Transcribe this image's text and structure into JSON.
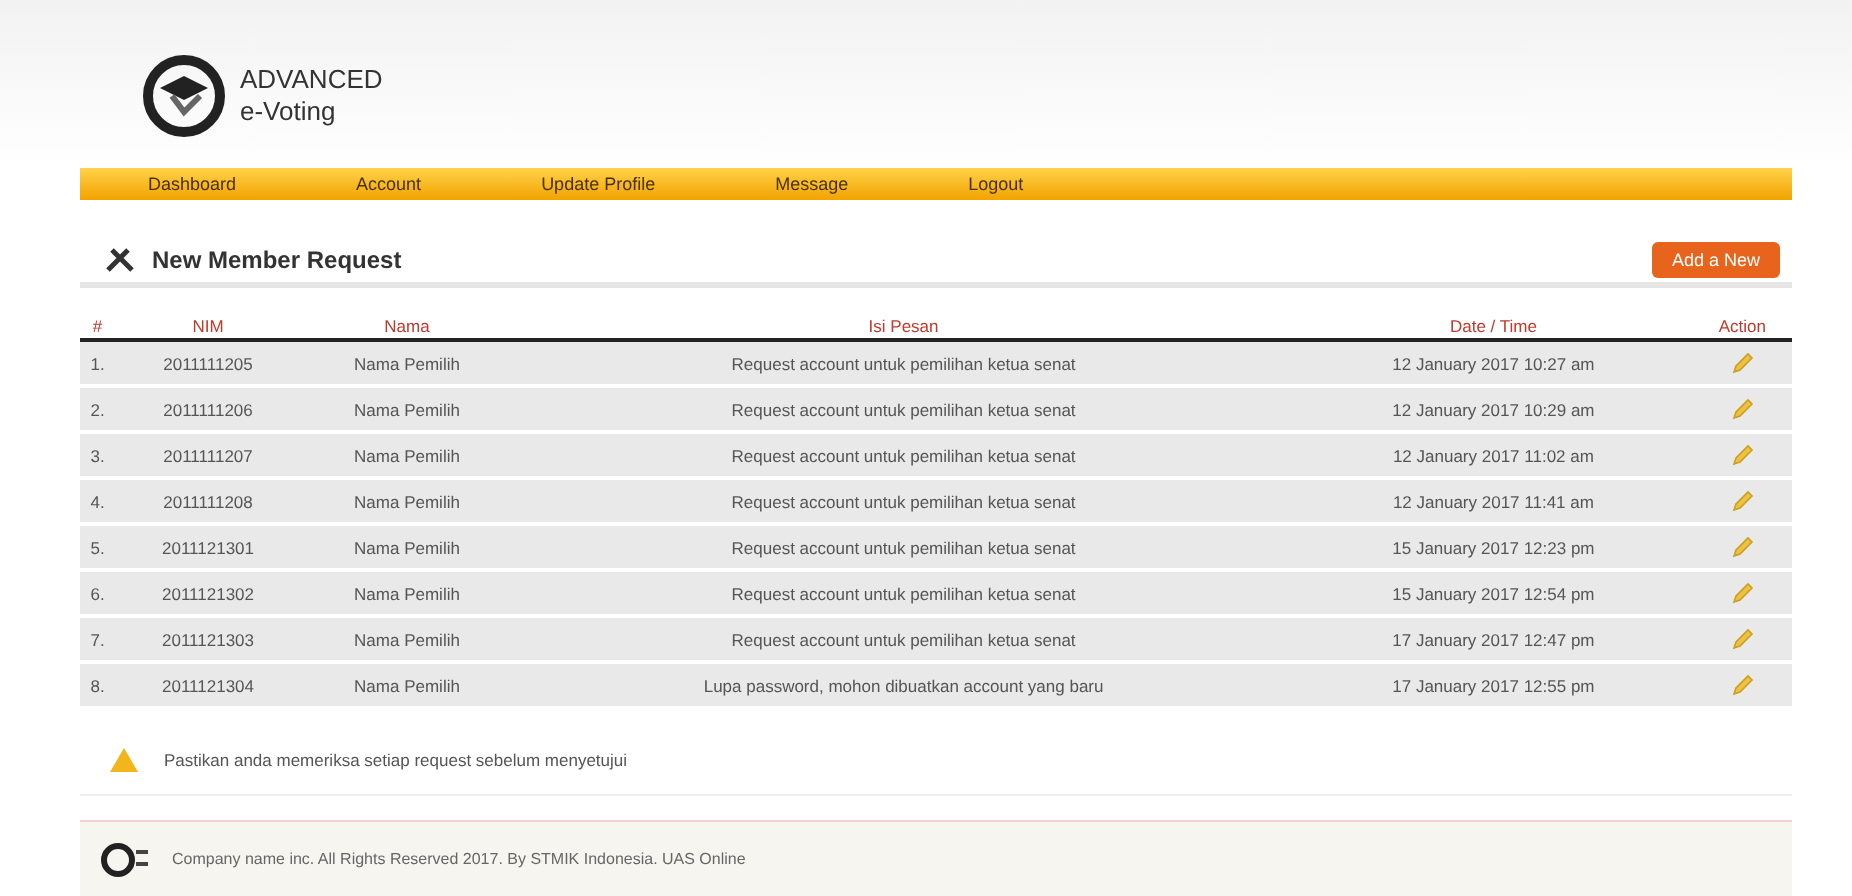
{
  "logo": {
    "line1": "ADVANCED",
    "line2": "e-Voting"
  },
  "nav": [
    {
      "label": "Dashboard"
    },
    {
      "label": "Account"
    },
    {
      "label": "Update Profile"
    },
    {
      "label": "Message"
    },
    {
      "label": "Logout"
    }
  ],
  "page": {
    "title": "New Member Request",
    "add_button": "Add a New"
  },
  "table": {
    "columns": [
      "#",
      "NIM",
      "Nama",
      "Isi Pesan",
      "Date / Time",
      "Action"
    ],
    "rows": [
      {
        "no": "1.",
        "nim": "2011111205",
        "name": "Nama Pemilih",
        "message": "Request account untuk pemilihan ketua senat",
        "time": "12 January 2017 10:27 am"
      },
      {
        "no": "2.",
        "nim": "2011111206",
        "name": "Nama Pemilih",
        "message": "Request account untuk pemilihan ketua senat",
        "time": "12 January 2017 10:29 am"
      },
      {
        "no": "3.",
        "nim": "2011111207",
        "name": "Nama Pemilih",
        "message": "Request account untuk pemilihan ketua senat",
        "time": "12 January 2017 11:02 am"
      },
      {
        "no": "4.",
        "nim": "2011111208",
        "name": "Nama Pemilih",
        "message": "Request account untuk pemilihan ketua senat",
        "time": "12 January 2017 11:41 am"
      },
      {
        "no": "5.",
        "nim": "2011121301",
        "name": "Nama Pemilih",
        "message": "Request account untuk pemilihan ketua senat",
        "time": "15 January 2017 12:23 pm"
      },
      {
        "no": "6.",
        "nim": "2011121302",
        "name": "Nama Pemilih",
        "message": "Request account untuk pemilihan ketua senat",
        "time": "15 January 2017 12:54 pm"
      },
      {
        "no": "7.",
        "nim": "2011121303",
        "name": "Nama Pemilih",
        "message": "Request account untuk pemilihan ketua senat",
        "time": "17 January 2017 12:47 pm"
      },
      {
        "no": "8.",
        "nim": "2011121304",
        "name": "Nama Pemilih",
        "message": "Lupa password, mohon dibuatkan account yang baru",
        "time": "17 January 2017 12:55 pm"
      }
    ]
  },
  "notice": "Pastikan anda memeriksa setiap request sebelum menyetujui",
  "footer": "Company name inc. All Rights Reserved 2017. By STMIK Indonesia. UAS Online"
}
